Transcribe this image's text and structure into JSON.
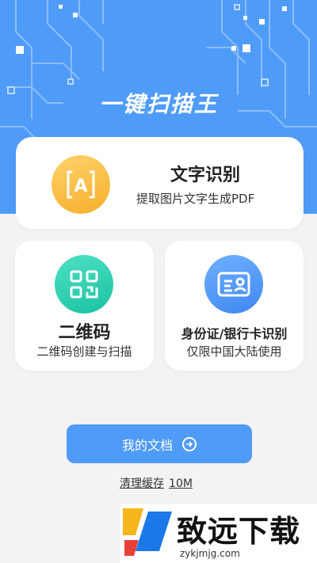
{
  "header": {
    "app_title": "一键扫描王",
    "background_color": "#4f9bf8"
  },
  "cards": {
    "text_recognition": {
      "title": "文字识别",
      "subtitle": "提取图片文字生成PDF",
      "icon": "text-recognition-icon",
      "icon_letter": "A"
    },
    "qr_code": {
      "title": "二维码",
      "subtitle": "二维码创建与扫描",
      "icon": "qr-code-icon"
    },
    "id_card": {
      "title": "身份证/银行卡识别",
      "subtitle": "仅限中国大陆使用",
      "icon": "id-card-icon"
    }
  },
  "actions": {
    "my_documents_label": "我的文档",
    "clear_cache_label": "清理缓存",
    "cache_size": "10M"
  },
  "watermark": {
    "name": "致远下载",
    "url": "zykjmjg.com"
  }
}
